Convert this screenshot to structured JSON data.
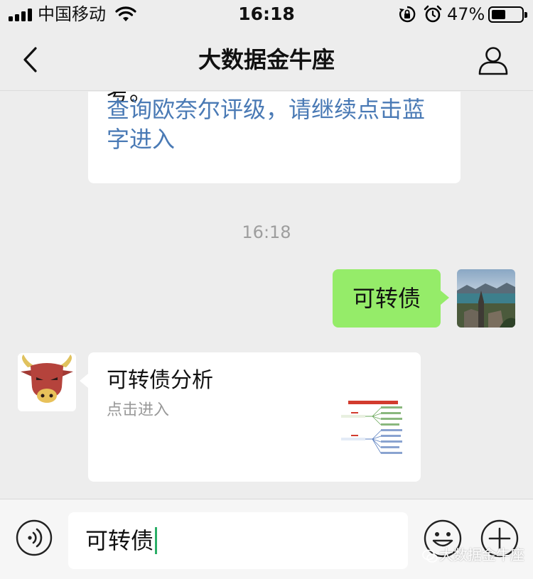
{
  "status_bar": {
    "carrier": "中国移动",
    "time": "16:18",
    "battery_percent": "47%",
    "battery_level": 0.47
  },
  "nav": {
    "title": "大数据金牛座"
  },
  "messages": {
    "partial_text": "考。",
    "link_text": "查询欧奈尔评级，请继续点击蓝字进入",
    "timestamp": "16:18",
    "my_message": "可转债",
    "card_title": "可转债分析",
    "card_desc": "点击进入"
  },
  "input": {
    "value": "可转债"
  },
  "watermark": {
    "text": "大数据金牛座"
  },
  "colors": {
    "my_bubble": "#95ec69",
    "link": "#4a7ab5",
    "caret": "#2aae67"
  }
}
